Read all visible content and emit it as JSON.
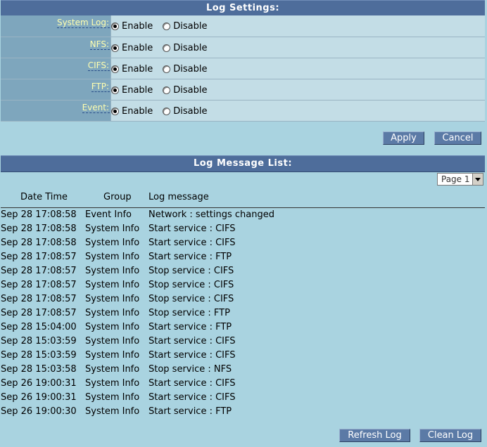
{
  "settings": {
    "title": "Log Settings:",
    "enable_label": "Enable",
    "disable_label": "Disable",
    "rows": [
      {
        "label": "System Log:",
        "value": "Enable"
      },
      {
        "label": "NFS:",
        "value": "Enable"
      },
      {
        "label": "CIFS:",
        "value": "Enable"
      },
      {
        "label": "FTP:",
        "value": "Enable"
      },
      {
        "label": "Event:",
        "value": "Enable"
      }
    ],
    "apply_label": "Apply",
    "cancel_label": "Cancel"
  },
  "log_list": {
    "title": "Log Message List:",
    "page_select": "Page 1",
    "columns": [
      "Date Time",
      "Group",
      "Log message"
    ],
    "rows": [
      {
        "date": "Sep 28 17:08:58",
        "group": "Event Info",
        "message": "Network : settings changed"
      },
      {
        "date": "Sep 28 17:08:58",
        "group": "System Info",
        "message": "Start service : CIFS"
      },
      {
        "date": "Sep 28 17:08:58",
        "group": "System Info",
        "message": "Start service : CIFS"
      },
      {
        "date": "Sep 28 17:08:57",
        "group": "System Info",
        "message": "Start service : FTP"
      },
      {
        "date": "Sep 28 17:08:57",
        "group": "System Info",
        "message": "Stop service : CIFS"
      },
      {
        "date": "Sep 28 17:08:57",
        "group": "System Info",
        "message": "Stop service : CIFS"
      },
      {
        "date": "Sep 28 17:08:57",
        "group": "System Info",
        "message": "Stop service : CIFS"
      },
      {
        "date": "Sep 28 17:08:57",
        "group": "System Info",
        "message": "Stop service : FTP"
      },
      {
        "date": "Sep 28 15:04:00",
        "group": "System Info",
        "message": "Start service : FTP"
      },
      {
        "date": "Sep 28 15:03:59",
        "group": "System Info",
        "message": "Start service : CIFS"
      },
      {
        "date": "Sep 28 15:03:59",
        "group": "System Info",
        "message": "Start service : CIFS"
      },
      {
        "date": "Sep 28 15:03:58",
        "group": "System Info",
        "message": "Stop service : NFS"
      },
      {
        "date": "Sep 26 19:00:31",
        "group": "System Info",
        "message": "Start service : CIFS"
      },
      {
        "date": "Sep 26 19:00:31",
        "group": "System Info",
        "message": "Start service : CIFS"
      },
      {
        "date": "Sep 26 19:00:30",
        "group": "System Info",
        "message": "Start service : FTP"
      }
    ],
    "refresh_label": "Refresh Log",
    "clean_label": "Clean Log"
  },
  "colors": {
    "header_bg": "#4e6d9b",
    "page_bg": "#a9d3e0",
    "label_bg": "#7ea6bd",
    "label_text": "#ffffb0",
    "option_bg": "#c3dde6",
    "button_bg": "#5b7aa6"
  }
}
